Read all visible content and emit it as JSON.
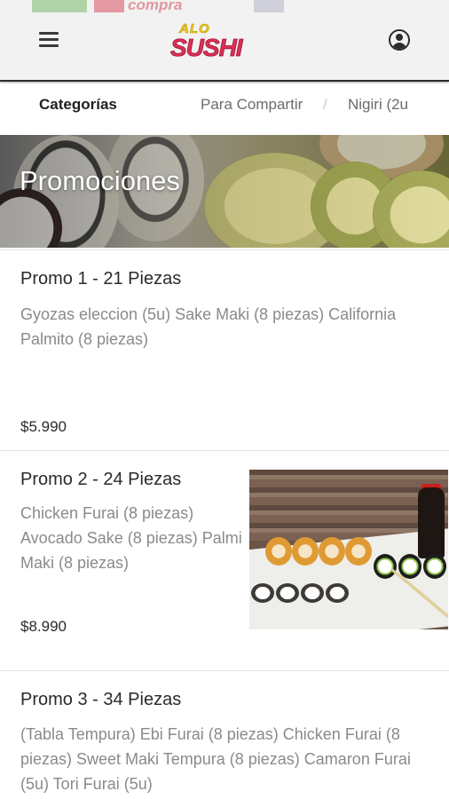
{
  "header": {
    "banner_text": "compra",
    "logo_top": "ALO",
    "logo_main": "SUSHI"
  },
  "tabs": [
    {
      "label": "Categorías"
    },
    {
      "label": "Para Compartir"
    },
    {
      "label": "Nigiri (2u"
    }
  ],
  "tab_separator": "/",
  "hero": {
    "title": "Promociones"
  },
  "promos": [
    {
      "name": "Promo 1 - 21 Piezas",
      "description": "Gyozas eleccion (5u) Sake Maki (8 piezas) California Palmito (8 piezas)",
      "price": "$5.990"
    },
    {
      "name": "Promo 2 - 24 Piezas",
      "description": "Chicken Furai (8 piezas) Avocado Sake (8 piezas) Palmi Maki (8 piezas)",
      "price": "$8.990"
    },
    {
      "name": "Promo 3 - 34 Piezas",
      "description": "(Tabla Tempura) Ebi Furai (8 piezas) Chicken Furai (8 piezas) Sweet Maki Tempura (8 piezas) Camaron Furai (5u) Tori Furai (5u)"
    }
  ],
  "icons": {
    "menu": "hamburger-menu-icon",
    "account": "user-account-icon"
  },
  "colors": {
    "brand_red": "#dc2f55",
    "brand_yellow": "#f0c81c",
    "header_bg": "#f2f2f2",
    "muted_text": "#8a8a8a"
  }
}
